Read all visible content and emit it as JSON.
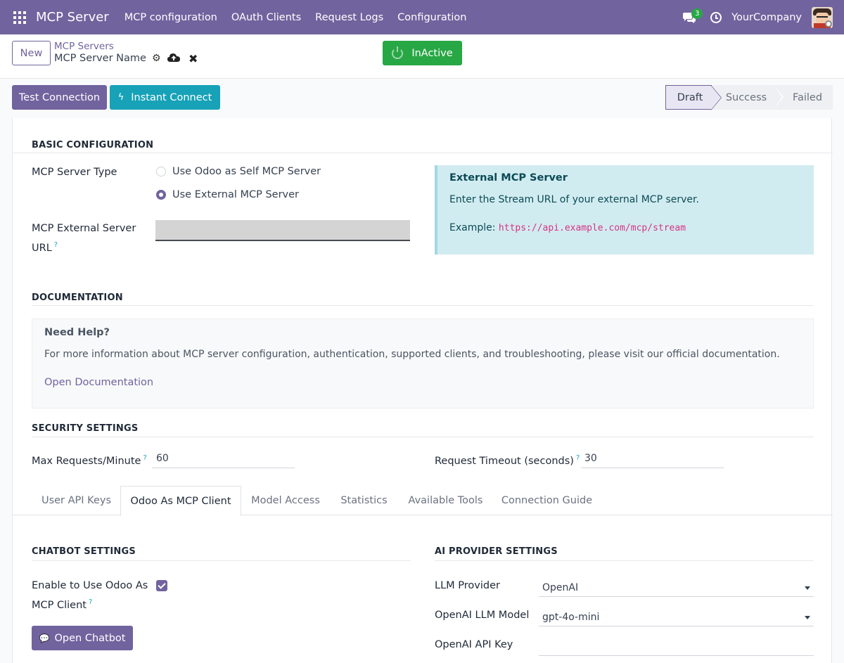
{
  "navbar": {
    "brand": "MCP Server",
    "menu": [
      "MCP configuration",
      "OAuth Clients",
      "Request Logs",
      "Configuration"
    ],
    "message_count": "3",
    "company": "YourCompany",
    "icons": [
      "apps-grid-icon",
      "chat-icon",
      "clock-icon",
      "user-avatar"
    ]
  },
  "control": {
    "new_label": "New",
    "breadcrumb_parent": "MCP Servers",
    "breadcrumb_current": "MCP Server Name",
    "status_button": "InActive"
  },
  "actions": {
    "test_connection": "Test Connection",
    "instant_connect": "Instant Connect",
    "statusbar": [
      "Draft",
      "Success",
      "Failed"
    ],
    "active_status": "Draft"
  },
  "basic": {
    "title": "BASIC CONFIGURATION",
    "server_type_label": "MCP Server Type",
    "options": [
      "Use Odoo as Self MCP Server",
      "Use External MCP Server"
    ],
    "selected_option": "Use External MCP Server",
    "url_label_1": "MCP External Server",
    "url_label_2": "URL",
    "url_help": "?",
    "info_title": "External MCP Server",
    "info_text": "Enter the Stream URL of your external MCP server.",
    "info_example_label": "Example:",
    "info_example_url": "https://api.example.com/mcp/stream"
  },
  "documentation": {
    "title": "DOCUMENTATION",
    "help_title": "Need Help?",
    "help_text": "For more information about MCP server configuration, authentication, supported clients, and troubleshooting, please visit our official documentation.",
    "link": "Open Documentation"
  },
  "security": {
    "title": "SECURITY SETTINGS",
    "max_requests_label": "Max Requests/Minute",
    "max_requests_value": "60",
    "timeout_label": "Request Timeout (seconds)",
    "timeout_value": "30",
    "help": "?"
  },
  "tabs": [
    "User API Keys",
    "Odoo As MCP Client",
    "Model Access",
    "Statistics",
    "Available Tools",
    "Connection Guide"
  ],
  "active_tab": "Odoo As MCP Client",
  "chatbot": {
    "title": "CHATBOT SETTINGS",
    "enable_label_1": "Enable to Use Odoo As",
    "enable_label_2": "MCP Client",
    "enabled": true,
    "open_chatbot": "Open Chatbot",
    "help": "?"
  },
  "ai_provider": {
    "title": "AI PROVIDER SETTINGS",
    "llm_provider_label": "LLM Provider",
    "llm_provider_value": "OpenAI",
    "model_label": "OpenAI LLM Model",
    "model_value": "gpt-4o-mini",
    "api_key_label": "OpenAI API Key",
    "api_key_value": ""
  },
  "colors": {
    "brand": "#71639e",
    "success": "#28a745",
    "info": "#17a2b8",
    "info_bg": "#d1ecf1"
  }
}
